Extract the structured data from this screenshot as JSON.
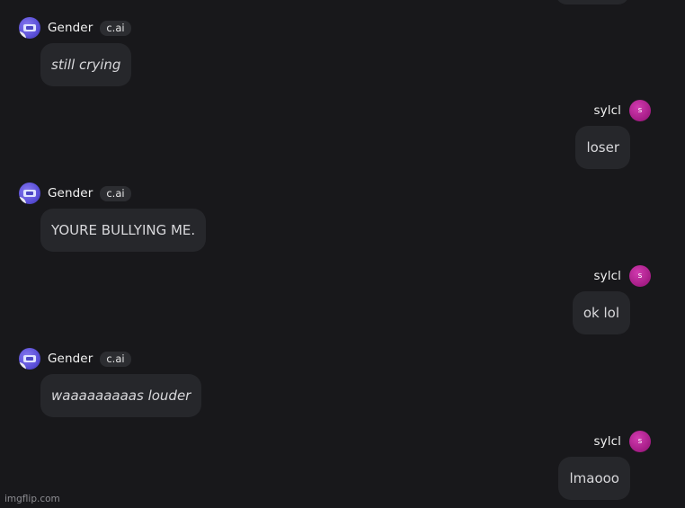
{
  "messages": [
    {
      "sender": "bot",
      "name": "Gender",
      "badge": "c.ai",
      "text": "still crying",
      "italic": true
    },
    {
      "sender": "user",
      "name": "sylcl",
      "avatar_letter": "s",
      "text": "loser",
      "italic": false
    },
    {
      "sender": "bot",
      "name": "Gender",
      "badge": "c.ai",
      "text": "YOURE BULLYING ME.",
      "italic": false
    },
    {
      "sender": "user",
      "name": "sylcl",
      "avatar_letter": "s",
      "text": "ok lol",
      "italic": false
    },
    {
      "sender": "bot",
      "name": "Gender",
      "badge": "c.ai",
      "text": "waaaaaaaaas louder",
      "italic": true
    },
    {
      "sender": "user",
      "name": "sylcl",
      "avatar_letter": "s",
      "text": "lmaooo",
      "italic": false
    }
  ],
  "watermark": "imgflip.com",
  "colors": {
    "background": "#18181b",
    "bubble": "#26272b",
    "bot_avatar": "#5a4fd8",
    "user_avatar": "#a41c85"
  }
}
